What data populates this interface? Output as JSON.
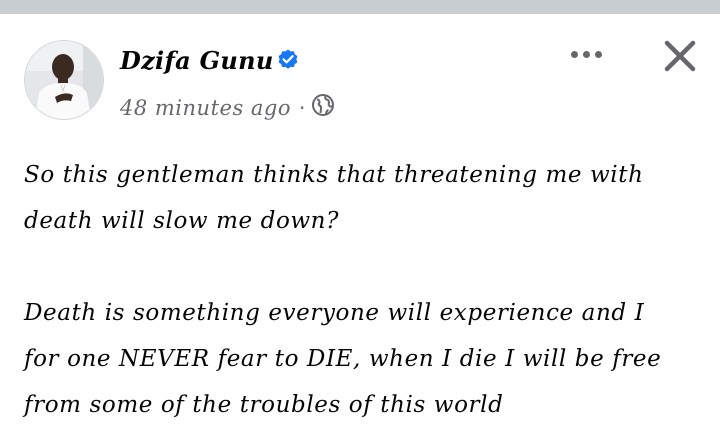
{
  "post": {
    "author": "Dzifa Gunu",
    "verified": true,
    "timestamp": "48 minutes ago",
    "separator": "·",
    "audience_icon": "globe-icon",
    "paragraphs": [
      {
        "lines": [
          "So this gentleman thinks that threatening me with",
          "death will slow me down?"
        ]
      },
      {
        "lines": [
          "Death is something everyone will experience and I",
          "for one NEVER fear to DIE, when I die I will be free",
          "from some of the troubles of this world"
        ]
      }
    ]
  },
  "header": {
    "more_icon": "more-horizontal-icon",
    "close_icon": "close-icon"
  },
  "colors": {
    "top_strip": "#c9ccd1",
    "verified_badge": "#1877f2",
    "secondary_text": "#65676b",
    "primary_text": "#050505",
    "background": "#ffffff"
  }
}
